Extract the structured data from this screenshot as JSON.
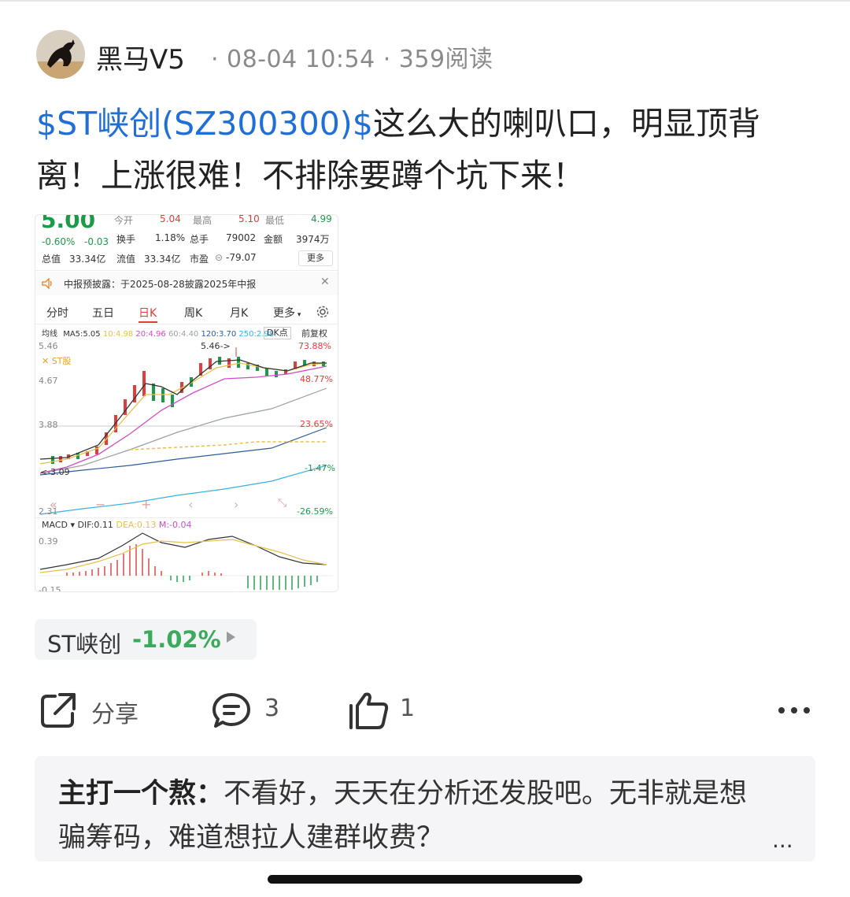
{
  "post": {
    "author": "黑马V5",
    "time": "08-04 10:54",
    "reads": "359阅读",
    "stock_link": "$ST峡创(SZ300300)$",
    "body": "这么大的喇叭口，明显顶背离！上涨很难！不排除要蹲个坑下来！"
  },
  "quote_card": {
    "price": "5.00",
    "change_pct": "-0.60%",
    "change_amt": "-0.03",
    "row0": [
      "今开",
      "5.04",
      "最高",
      "5.10",
      "最低",
      "4.99"
    ],
    "row1": [
      {
        "label": "换手",
        "value": "1.18%"
      },
      {
        "label": "总手",
        "value": "79002"
      },
      {
        "label": "金额",
        "value": "3974万"
      }
    ],
    "row2": [
      {
        "label": "总值",
        "value": "33.34亿"
      },
      {
        "label": "流值",
        "value": "33.34亿"
      },
      {
        "label": "市盈",
        "value": "-79.07"
      }
    ],
    "more_button": "更多",
    "notice": "中报预披露：于2025-08-28披露2025年中报",
    "tabs": [
      "分时",
      "五日",
      "日K",
      "周K",
      "月K",
      "更多"
    ],
    "active_tab": "日K",
    "ma_bar": {
      "label": "均线",
      "ma5": "MA5:5.05",
      "ma10": "10:4.98",
      "ma20": "20:4.96",
      "ma60": "60:4.40",
      "ma120": "120:3.70",
      "ma250": "250:2.98",
      "dk": "DK点",
      "adjust": "前复权"
    },
    "colors": {
      "ma5": "#333333",
      "ma10": "#e8c04a",
      "ma20": "#d24cc8",
      "ma60": "#9aa0a6",
      "ma120": "#2e5c9a",
      "ma250": "#3ab0e0",
      "up": "#e23c3c",
      "down": "#1b9b48"
    },
    "badge": "ST股",
    "y_labels": [
      "5.46",
      "4.67",
      "3.88",
      "2.31"
    ],
    "pct_labels": [
      "73.88%",
      "48.77%",
      "23.65%",
      "-1.47%",
      "-26.59%"
    ],
    "annot_high": "5.46->",
    "annot_low": "<-3.09",
    "zoom_controls": [
      "«",
      "−",
      "+",
      "‹",
      "›",
      "⤡"
    ],
    "macd": {
      "label": "MACD",
      "dif": "DIF:0.11",
      "dea": "DEA:0.13",
      "m": "M:-0.04",
      "top": "0.39",
      "bottom": "-0.15"
    }
  },
  "chip": {
    "name": "ST峡创",
    "change": "-1.02%"
  },
  "actions": {
    "share": "分享",
    "comments": "3",
    "likes": "1"
  },
  "comment": {
    "author": "主打一个熬：",
    "text": "不看好，天天在分析还发股吧。无非就是想骗筹码，难道想拉人建群收费？",
    "more": "..."
  }
}
